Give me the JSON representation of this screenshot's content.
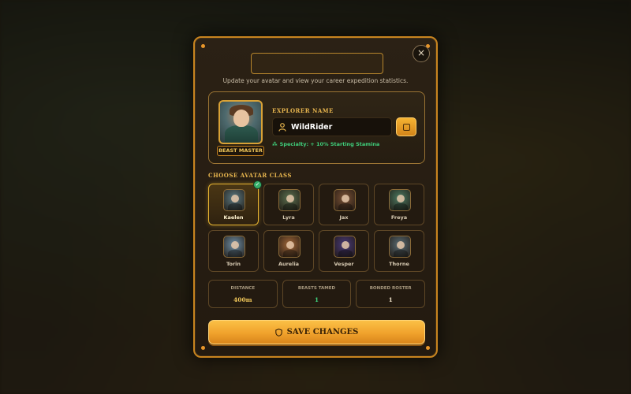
{
  "modal": {
    "title": "",
    "subtitle": "Update your avatar and view your career expedition statistics.",
    "close_icon": "×"
  },
  "profile": {
    "role_badge": "BEAST MASTER",
    "name_label": "EXPLORER NAME",
    "name_value": "WildRider",
    "specialty_icon": "⁂",
    "specialty": "Specialty: + 10% Starting Stamina"
  },
  "classes": {
    "label": "CHOOSE AVATAR CLASS",
    "selected": "Kaelen",
    "items": [
      {
        "name": "Kaelen",
        "color": "#5d7a82"
      },
      {
        "name": "Lyra",
        "color": "#5b7050"
      },
      {
        "name": "Jax",
        "color": "#7a5136"
      },
      {
        "name": "Freya",
        "color": "#4d7a62"
      },
      {
        "name": "Torin",
        "color": "#6f8fa6"
      },
      {
        "name": "Aurelia",
        "color": "#a2683a"
      },
      {
        "name": "Vesper",
        "color": "#4a3a78"
      },
      {
        "name": "Thorne",
        "color": "#5a6c74"
      }
    ]
  },
  "stats": [
    {
      "label": "DISTANCE",
      "value": "400m",
      "color": "#f2c85a"
    },
    {
      "label": "BEASTS TAMED",
      "value": "1",
      "color": "#3fd07c"
    },
    {
      "label": "BONDED ROSTER",
      "value": "1",
      "color": "#e9dcc4"
    }
  ],
  "save_button": {
    "label": "SAVE CHANGES"
  },
  "colors": {
    "accent": "#c8841f",
    "gold_text": "#e7b54e",
    "success": "#3fd07c"
  }
}
